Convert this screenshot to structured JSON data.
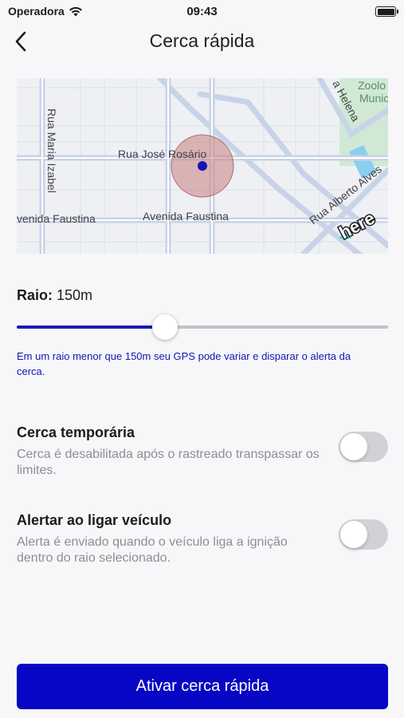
{
  "status_bar": {
    "carrier": "Operadora",
    "time": "09:43"
  },
  "header": {
    "title": "Cerca rápida"
  },
  "map": {
    "streets": {
      "rua_maria_izabel": "Rua Maria Izabel",
      "rua_jose_rosario": "Rua José Rosário",
      "avenida_faustina_left": "venida Faustina",
      "avenida_faustina_right": "Avenida Faustina",
      "rua_alberto_alves": "Rua Alberto Alves",
      "helena": "a Helena",
      "zoo_line1": "Zoolo",
      "zoo_line2": "Munic"
    },
    "logo": "here",
    "colors": {
      "fence": "#c97f7f",
      "marker": "#1414b4",
      "park": "#cfe9d5",
      "water": "#8ccdf2"
    }
  },
  "radius": {
    "label": "Raio:",
    "value": "150m",
    "slider_fraction": 0.4
  },
  "hint": "Em um raio menor que 150m seu GPS pode variar e disparar o alerta da cerca.",
  "options": [
    {
      "title": "Cerca temporária",
      "description": "Cerca é desabilitada após o rastreado transpassar os limites.",
      "enabled": false
    },
    {
      "title": "Alertar ao ligar veículo",
      "description": "Alerta é enviado quando o veículo liga a ignição dentro do raio selecionado.",
      "enabled": false
    }
  ],
  "button": {
    "label": "Ativar cerca rápida"
  },
  "colors": {
    "accent": "#0606c4",
    "hint_text": "#1414b4",
    "toggle_off": "#d1d1d6"
  }
}
